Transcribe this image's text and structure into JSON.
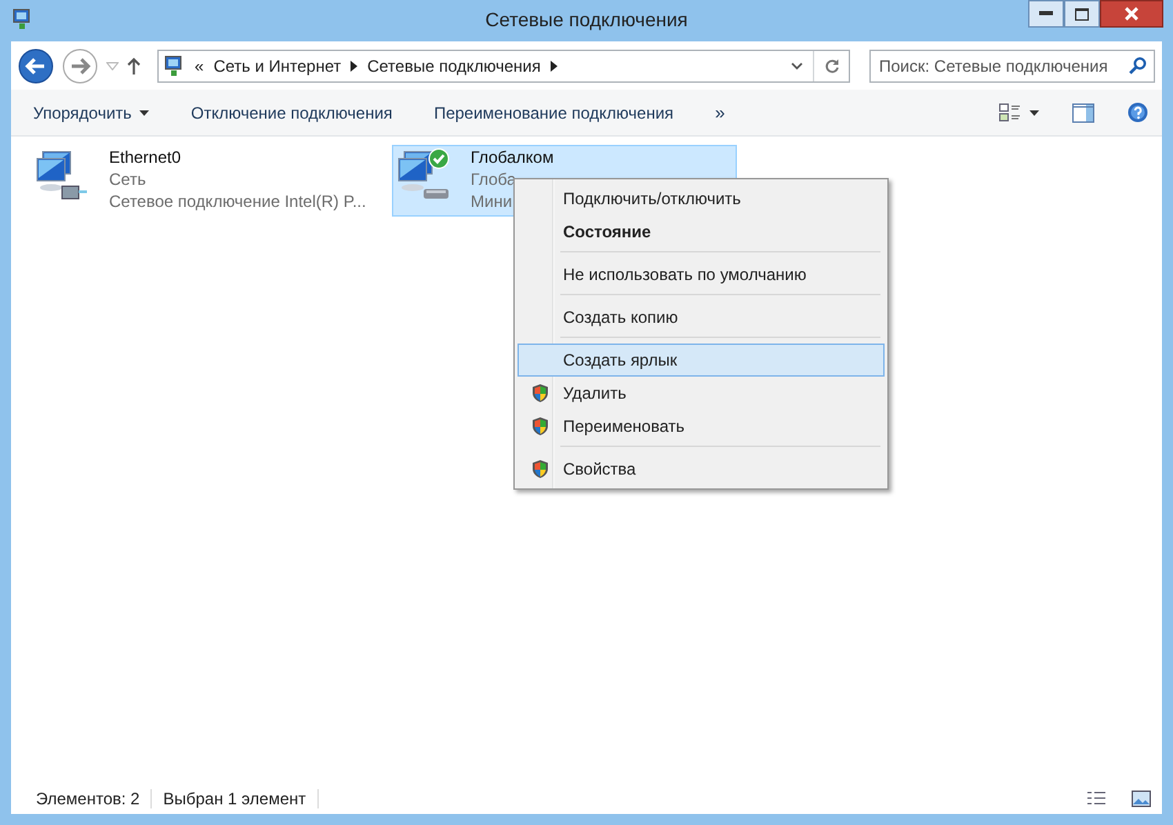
{
  "window": {
    "title": "Сетевые подключения"
  },
  "address": {
    "prefix": "«",
    "crumbs": [
      "Сеть и Интернет",
      "Сетевые подключения"
    ]
  },
  "search": {
    "placeholder": "Поиск: Сетевые подключения"
  },
  "commands": [
    {
      "label": "Упорядочить",
      "dropdown": true
    },
    {
      "label": "Отключение подключения",
      "dropdown": false
    },
    {
      "label": "Переименование подключения",
      "dropdown": false
    }
  ],
  "more": "»",
  "connections": [
    {
      "name": "Ethernet0",
      "line_2": "Сеть",
      "line_3": "Сетевое подключение Intel(R) P...",
      "selected": false,
      "connected": false,
      "kind": "ethernet"
    },
    {
      "name": "Глобалком",
      "line_2": "Глоба",
      "line_3": "Мини",
      "selected": true,
      "connected": true,
      "kind": "modem"
    }
  ],
  "context_menu": [
    {
      "label": "Подключить/отключить",
      "bold": false,
      "shield": false,
      "selected": false,
      "separator_after": false
    },
    {
      "label": "Состояние",
      "bold": true,
      "shield": false,
      "selected": false,
      "separator_after": true
    },
    {
      "label": "Не использовать по умолчанию",
      "bold": false,
      "shield": false,
      "selected": false,
      "separator_after": true
    },
    {
      "label": "Создать копию",
      "bold": false,
      "shield": false,
      "selected": false,
      "separator_after": true
    },
    {
      "label": "Создать ярлык",
      "bold": false,
      "shield": false,
      "selected": true,
      "separator_after": false
    },
    {
      "label": "Удалить",
      "bold": false,
      "shield": true,
      "selected": false,
      "separator_after": false
    },
    {
      "label": "Переименовать",
      "bold": false,
      "shield": true,
      "selected": false,
      "separator_after": true
    },
    {
      "label": "Свойства",
      "bold": false,
      "shield": true,
      "selected": false,
      "separator_after": false
    }
  ],
  "status_bar": [
    "Элементов: 2",
    "Выбран 1 элемент"
  ]
}
